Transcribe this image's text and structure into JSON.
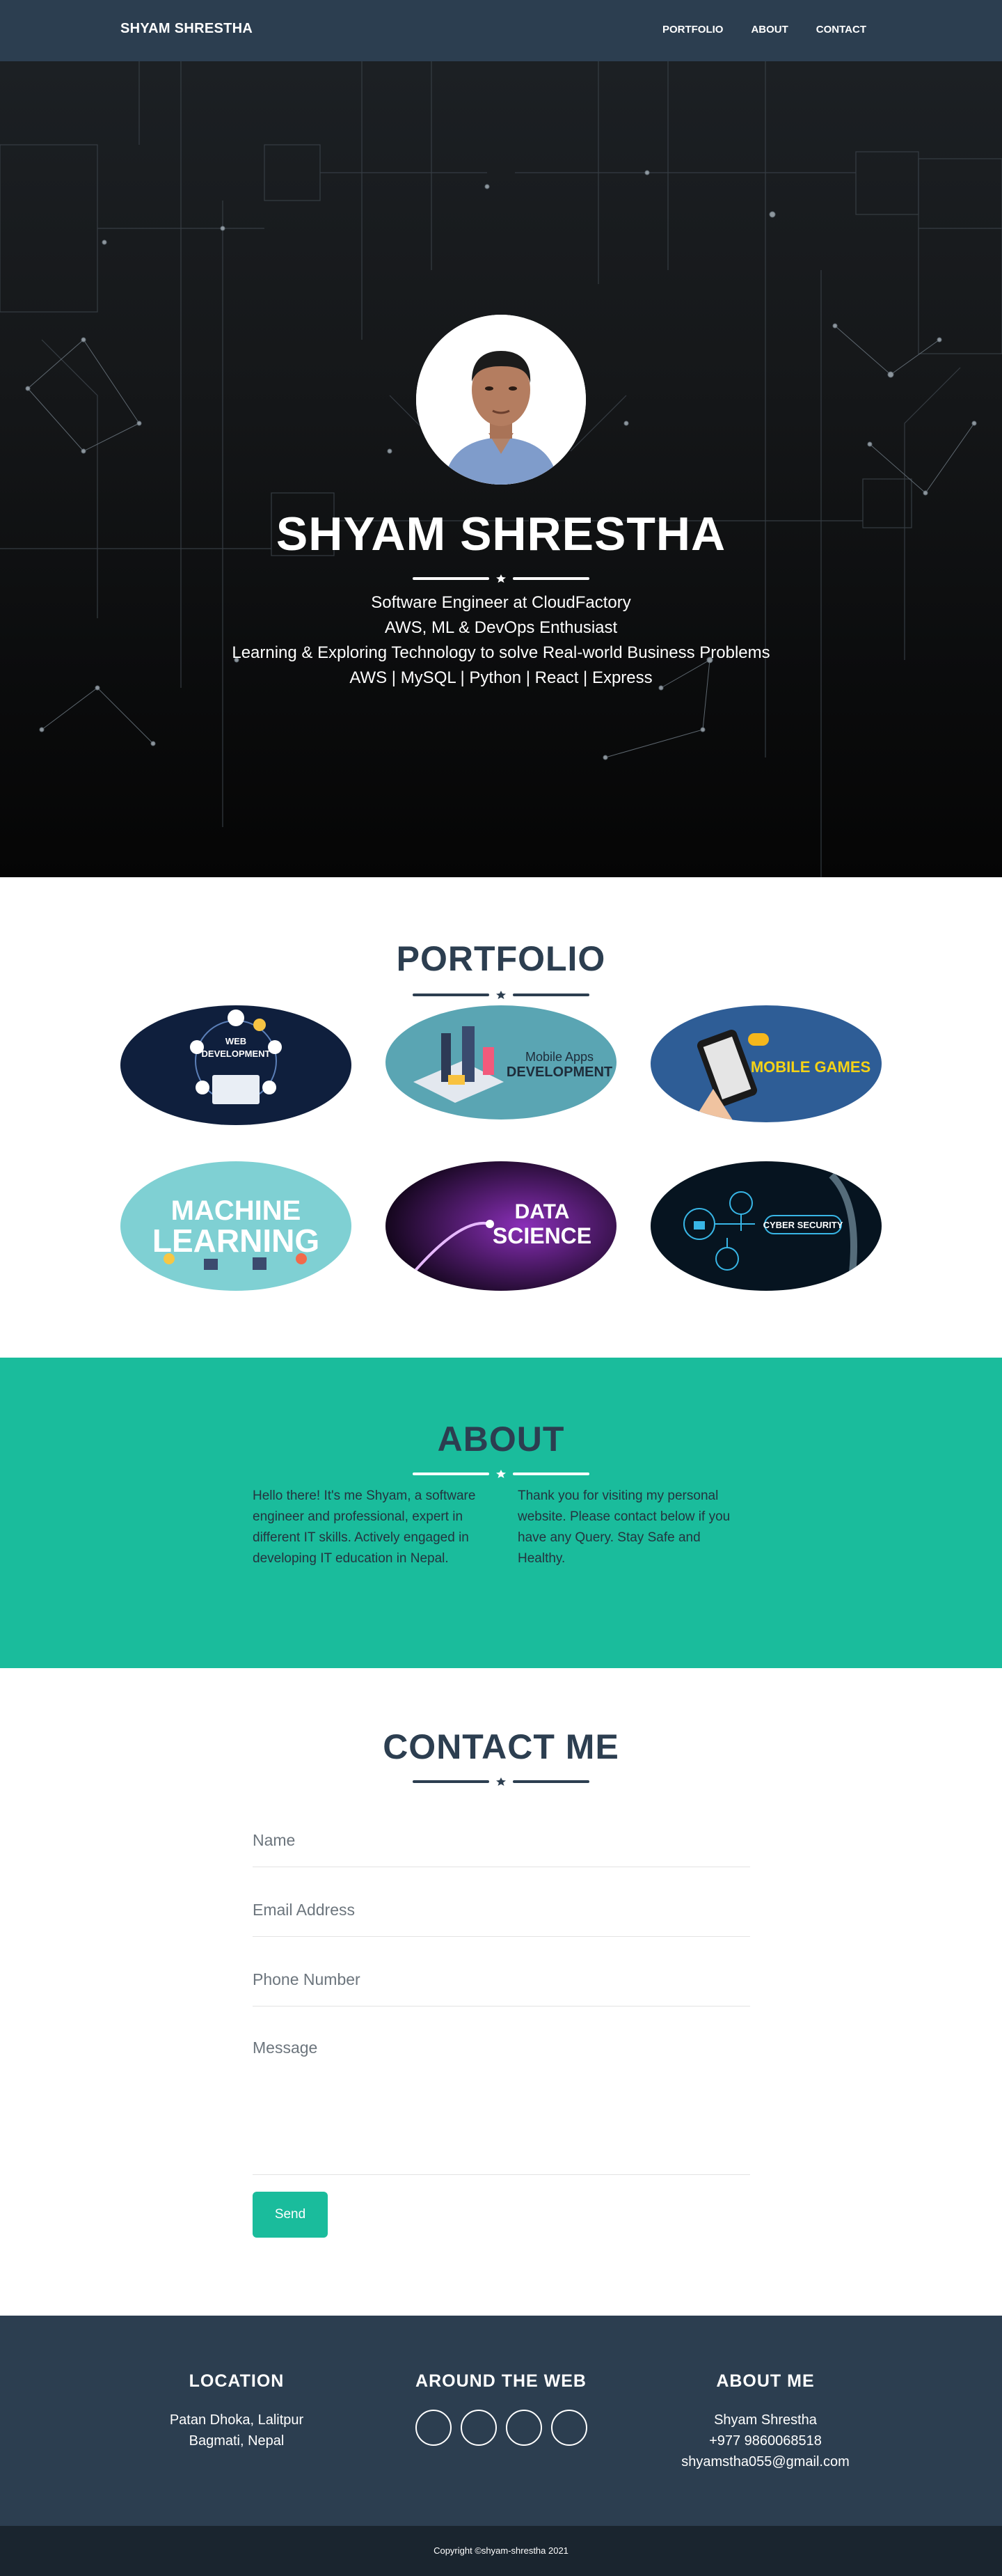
{
  "navbar": {
    "brand": "SHYAM SHRESTHA",
    "links": [
      "PORTFOLIO",
      "ABOUT",
      "CONTACT"
    ]
  },
  "hero": {
    "name": "SHYAM SHRESTHA",
    "lines": [
      "Software Engineer at CloudFactory",
      "AWS, ML & DevOps Enthusiast",
      "Learning & Exploring Technology to solve Real-world Business Problems",
      "AWS | MySQL | Python | React | Express"
    ]
  },
  "portfolio": {
    "title": "PORTFOLIO",
    "items": [
      {
        "text1": "WEB",
        "text2": "DEVELOPMENT",
        "bg": "#0f1f3d"
      },
      {
        "text1": "Mobile Apps",
        "text2": "DEVELOPMENT",
        "bg": "#5aa5b3"
      },
      {
        "text1": "MOBILE GAMES",
        "text2": "",
        "bg": "#2e5d96"
      },
      {
        "text1": "MACHINE",
        "text2": "LEARNING",
        "bg": "#7fd0d3"
      },
      {
        "text1": "DATA",
        "text2": "SCIENCE",
        "bg": "#2a0a3a"
      },
      {
        "text1": "CYBER SECURITY",
        "text2": "",
        "bg": "#061420"
      }
    ]
  },
  "about": {
    "title": "ABOUT",
    "left": "Hello there! It's me Shyam, a software engineer and professional, expert in different IT skills. Actively engaged in developing IT education in Nepal.",
    "right": "Thank you for visiting my personal website. Please contact below if you have any Query. Stay Safe and Healthy."
  },
  "contact": {
    "title": "CONTACT ME",
    "name_placeholder": "Name",
    "email_placeholder": "Email Address",
    "phone_placeholder": "Phone Number",
    "message_placeholder": "Message",
    "send_label": "Send"
  },
  "footer": {
    "location": {
      "title": "LOCATION",
      "line1": "Patan Dhoka, Lalitpur",
      "line2": "Bagmati, Nepal"
    },
    "web": {
      "title": "AROUND THE WEB"
    },
    "about": {
      "title": "ABOUT ME",
      "name": "Shyam Shrestha",
      "phone": "+977 9860068518",
      "email": "shyamstha055@gmail.com"
    },
    "copyright": "Copyright ©shyam-shrestha 2021"
  },
  "colors": {
    "navy": "#2c3e50",
    "teal": "#1abc9c",
    "dark": "#1a252f"
  }
}
